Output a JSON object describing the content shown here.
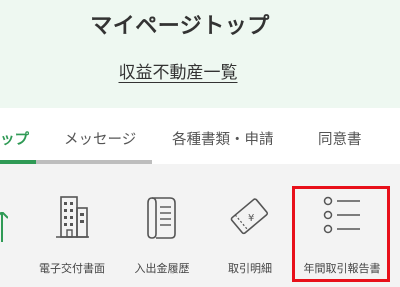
{
  "header": {
    "title": "マイページトップ",
    "sub_link": "収益不動産一覧"
  },
  "tabs": [
    {
      "label": "ップ",
      "active": true
    },
    {
      "label": "メッセージ",
      "active": false
    },
    {
      "label": "各種書類・申請",
      "active": false
    },
    {
      "label": "同意書",
      "active": false
    }
  ],
  "tiles": [
    {
      "label": "電子交付書面",
      "icon": "building-icon"
    },
    {
      "label": "入出金履歴",
      "icon": "scroll-icon"
    },
    {
      "label": "取引明細",
      "icon": "yen-ticket-icon"
    },
    {
      "label": "年間取引報告書",
      "icon": "list-icon"
    }
  ],
  "colors": {
    "accent": "#2f9a55",
    "highlight": "#e8101a",
    "header_bg": "#eef8f1"
  }
}
